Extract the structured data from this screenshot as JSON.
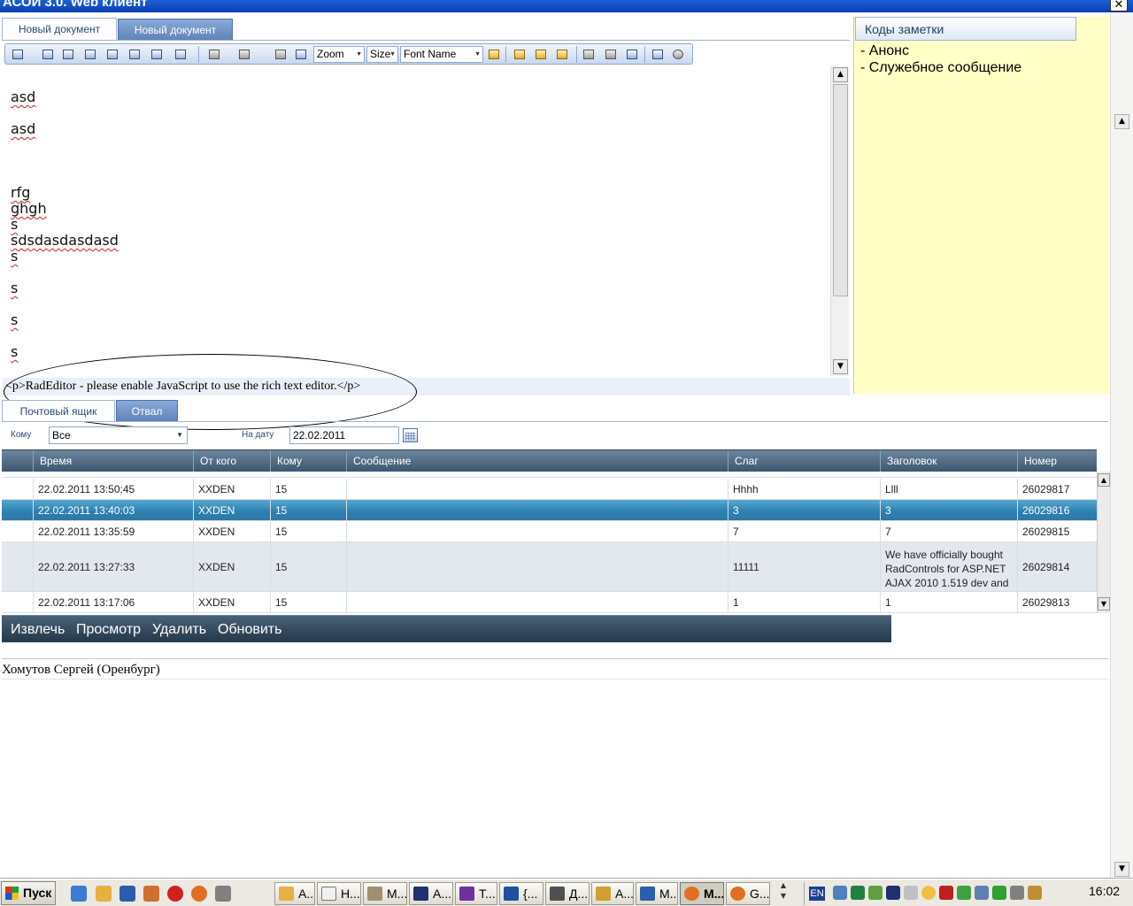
{
  "window": {
    "title": "АСОИ 3.0. Web клиент",
    "close_glyph": "✕"
  },
  "editor_tabs": [
    {
      "label": "Новый документ",
      "active": true
    },
    {
      "label": "Новый документ",
      "active": false
    }
  ],
  "toolbar": {
    "zoom_label": "Zoom",
    "size_label": "Size",
    "font_label": "Font Name",
    "icons_left": [
      "table-icon",
      "insert-row-icon",
      "delete-row-icon",
      "insert-column-icon",
      "delete-column-icon",
      "merge-cells-icon",
      "split-cells-icon",
      "table-properties-icon",
      "undo-icon",
      "redo-icon",
      "cut-icon",
      "copy-icon"
    ],
    "icons_right": [
      "paste-icon",
      "paste-word-icon",
      "paste-plain-icon",
      "paste-html-icon",
      "print-icon",
      "find-replace-icon",
      "fullscreen-icon",
      "html-mode-icon",
      "insert-date-icon"
    ]
  },
  "editor": {
    "lines": [
      "asd",
      "asd",
      "rfg",
      "ghgh",
      "s",
      "sdsdasdasdasd",
      "s",
      "s",
      "s",
      "s"
    ],
    "scroll_up_glyph": "▲",
    "scroll_down_glyph": "▼"
  },
  "rad_message": "<p>RadEditor - please enable JavaScript to use the rich text editor.</p>",
  "notes": {
    "header": "Коды заметки",
    "items": [
      "- Анонс",
      "- Служебное сообщение"
    ]
  },
  "mail_tabs": [
    {
      "label": "Почтовый ящик",
      "active": true
    },
    {
      "label": "Отвал",
      "active": false
    }
  ],
  "filters": {
    "to_label": "Кому",
    "to_value": "Все",
    "date_label": "На дату",
    "date_value": "22.02.2011"
  },
  "grid": {
    "columns": [
      "Время",
      "От кого",
      "Кому",
      "Сообщение",
      "Слаг",
      "Заголовок",
      "Номер"
    ],
    "rows": [
      {
        "time": "22.02.2011 13:50:45",
        "from": "XXDEN",
        "to": "15",
        "message": "",
        "slug": "Hhhh",
        "title": "Llll",
        "number": "26029817",
        "state": "normal"
      },
      {
        "time": "22.02.2011 13:40:03",
        "from": "XXDEN",
        "to": "15",
        "message": "",
        "slug": "3",
        "title": "3",
        "number": "26029816",
        "state": "selected"
      },
      {
        "time": "22.02.2011 13:35:59",
        "from": "XXDEN",
        "to": "15",
        "message": "",
        "slug": "7",
        "title": "7",
        "number": "26029815",
        "state": "normal"
      },
      {
        "time": "22.02.2011 13:27:33",
        "from": "XXDEN",
        "to": "15",
        "message": "",
        "slug": "11111",
        "title": "We have officially bought RadControls for ASP.NET AJAX 2010 1.519 dev and",
        "number": "26029814",
        "state": "alt"
      },
      {
        "time": "22.02.2011 13:17:06",
        "from": "XXDEN",
        "to": "15",
        "message": "",
        "slug": "1",
        "title": "1",
        "number": "26029813",
        "state": "normal"
      }
    ]
  },
  "actions": {
    "extract": "Извлечь",
    "view": "Просмотр",
    "delete": "Удалить",
    "refresh": "Обновить"
  },
  "footer": {
    "user": "Хомутов Сергей (Оренбург)"
  },
  "taskbar": {
    "start_label": "Пуск",
    "buttons": [
      "А...",
      "Н...",
      "М...",
      "А...",
      "Т...",
      "{...",
      "Д...",
      "А...",
      "М...",
      "М...",
      "G..."
    ],
    "lang": "EN",
    "clock": "16:02"
  }
}
